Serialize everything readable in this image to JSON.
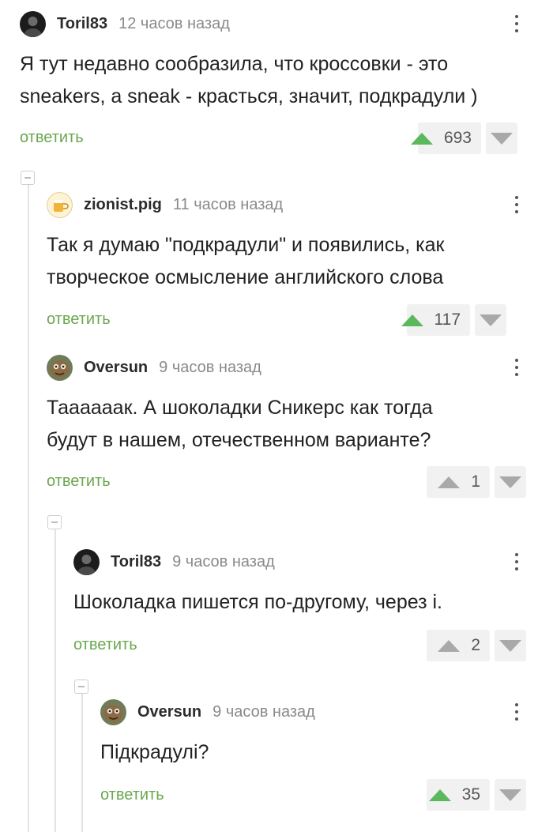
{
  "colors": {
    "accent_green": "#6aa84f",
    "upvote_green": "#5cb85c",
    "muted_gray": "#a9a9a9"
  },
  "comments": [
    {
      "username": "Toril83",
      "time": "12 часов назад",
      "text_lines": [
        "Я тут недавно сообразила, что кроссовки - это",
        "sneakers, a sneak - красться, значит, подкрадули )"
      ],
      "reply": "ответить",
      "votes": "693",
      "avatar_icon": "dark-portrait-avatar"
    },
    {
      "username": "zionist.pig",
      "time": "11 часов назад",
      "text_lines": [
        "Так я думаю \"подкрадули\" и появились, как",
        "творческое осмысление английского слова"
      ],
      "reply": "ответить",
      "votes": "117",
      "avatar_icon": "beer-mug-avatar"
    },
    {
      "username": "Oversun",
      "time": "9 часов назад",
      "text_lines": [
        "Тааааaак. А шоколадки Сникерс как тогда",
        "будут в нашем, отечественном варианте?"
      ],
      "reply": "ответить",
      "votes": "1",
      "avatar_icon": "creature-avatar"
    },
    {
      "username": "Toril83",
      "time": "9 часов назад",
      "text_lines": [
        "Шоколадка пишется по-другому, через і."
      ],
      "reply": "ответить",
      "votes": "2",
      "avatar_icon": "dark-portrait-avatar"
    },
    {
      "username": "Oversun",
      "time": "9 часов назад",
      "text_lines": [
        "Підкрадулі?"
      ],
      "reply": "ответить",
      "votes": "35",
      "avatar_icon": "creature-avatar"
    }
  ]
}
